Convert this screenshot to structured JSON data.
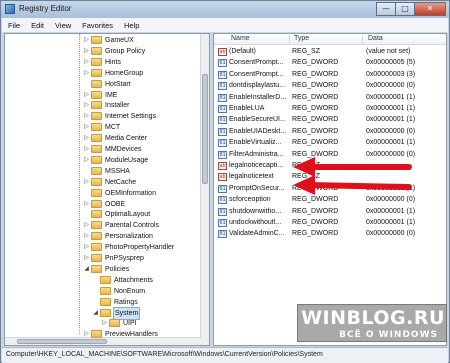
{
  "window": {
    "title": "Registry Editor",
    "controls": [
      "—",
      "□",
      "✕"
    ]
  },
  "menu": [
    "File",
    "Edit",
    "View",
    "Favorites",
    "Help"
  ],
  "tree": {
    "items": [
      {
        "label": "GameUX",
        "expander": "▷"
      },
      {
        "label": "Group Policy",
        "expander": "▷"
      },
      {
        "label": "Hints",
        "expander": "▷"
      },
      {
        "label": "HomeGroup",
        "expander": "▷"
      },
      {
        "label": "HotStart",
        "expander": ""
      },
      {
        "label": "IME",
        "expander": "▷"
      },
      {
        "label": "Installer",
        "expander": "▷"
      },
      {
        "label": "Internet Settings",
        "expander": "▷"
      },
      {
        "label": "MCT",
        "expander": "▷"
      },
      {
        "label": "Media Center",
        "expander": "▷"
      },
      {
        "label": "MMDevices",
        "expander": "▷"
      },
      {
        "label": "ModuleUsage",
        "expander": "▷"
      },
      {
        "label": "MSSHA",
        "expander": ""
      },
      {
        "label": "NetCache",
        "expander": "▷"
      },
      {
        "label": "OEMInformation",
        "expander": ""
      },
      {
        "label": "OOBE",
        "expander": "▷"
      },
      {
        "label": "OptimalLayout",
        "expander": ""
      },
      {
        "label": "Parental Controls",
        "expander": "▷"
      },
      {
        "label": "Personalization",
        "expander": "▷"
      },
      {
        "label": "PhotoPropertyHandler",
        "expander": "▷"
      },
      {
        "label": "PnPSysprep",
        "expander": "▷"
      },
      {
        "label": "Policies",
        "expander": "◢"
      },
      {
        "label": "Attachments",
        "expander": ""
      },
      {
        "label": "NonEnum",
        "expander": ""
      },
      {
        "label": "Ratings",
        "expander": ""
      },
      {
        "label": "System",
        "expander": "◢"
      },
      {
        "label": "UIPI",
        "expander": "▷"
      },
      {
        "label": "PreviewHandlers",
        "expander": "▷"
      }
    ]
  },
  "list": {
    "columns": [
      "Name",
      "Type",
      "Data"
    ],
    "rows": [
      {
        "name": "(Default)",
        "type": "REG_SZ",
        "data": "(value not set)",
        "kind": "sz"
      },
      {
        "name": "ConsentPrompt...",
        "type": "REG_DWORD",
        "data": "0x00000005 (5)",
        "kind": "dw"
      },
      {
        "name": "ConsentPrompt...",
        "type": "REG_DWORD",
        "data": "0x00000003 (3)",
        "kind": "dw"
      },
      {
        "name": "dontdisplaylastu...",
        "type": "REG_DWORD",
        "data": "0x00000000 (0)",
        "kind": "dw"
      },
      {
        "name": "EnableInstallerD...",
        "type": "REG_DWORD",
        "data": "0x00000001 (1)",
        "kind": "dw"
      },
      {
        "name": "EnableLUA",
        "type": "REG_DWORD",
        "data": "0x00000001 (1)",
        "kind": "dw"
      },
      {
        "name": "EnableSecureUI...",
        "type": "REG_DWORD",
        "data": "0x00000001 (1)",
        "kind": "dw"
      },
      {
        "name": "EnableUIADeskt...",
        "type": "REG_DWORD",
        "data": "0x00000000 (0)",
        "kind": "dw"
      },
      {
        "name": "EnableVirtualiz...",
        "type": "REG_DWORD",
        "data": "0x00000001 (1)",
        "kind": "dw"
      },
      {
        "name": "FilterAdministra...",
        "type": "REG_DWORD",
        "data": "0x00000000 (0)",
        "kind": "dw"
      },
      {
        "name": "legalnoticecapti...",
        "type": "REG_SZ",
        "data": "",
        "kind": "sz"
      },
      {
        "name": "legalnoticetext",
        "type": "REG_SZ",
        "data": "",
        "kind": "sz"
      },
      {
        "name": "PromptOnSecur...",
        "type": "REG_DWORD",
        "data": "0x00000001 (1)",
        "kind": "dw"
      },
      {
        "name": "scforceoption",
        "type": "REG_DWORD",
        "data": "0x00000000 (0)",
        "kind": "dw"
      },
      {
        "name": "shutdownwitho...",
        "type": "REG_DWORD",
        "data": "0x00000001 (1)",
        "kind": "dw"
      },
      {
        "name": "undockwithoutl...",
        "type": "REG_DWORD",
        "data": "0x00000001 (1)",
        "kind": "dw"
      },
      {
        "name": "ValidateAdminC...",
        "type": "REG_DWORD",
        "data": "0x00000000 (0)",
        "kind": "dw"
      }
    ]
  },
  "annotation_color": "#e0101a",
  "status": "Computer\\HKEY_LOCAL_MACHINE\\SOFTWARE\\Microsoft\\Windows\\CurrentVersion\\Policies\\System",
  "watermark": {
    "line1": "WINBLOG.RU",
    "line2": "ВСЁ О WINDOWS"
  }
}
